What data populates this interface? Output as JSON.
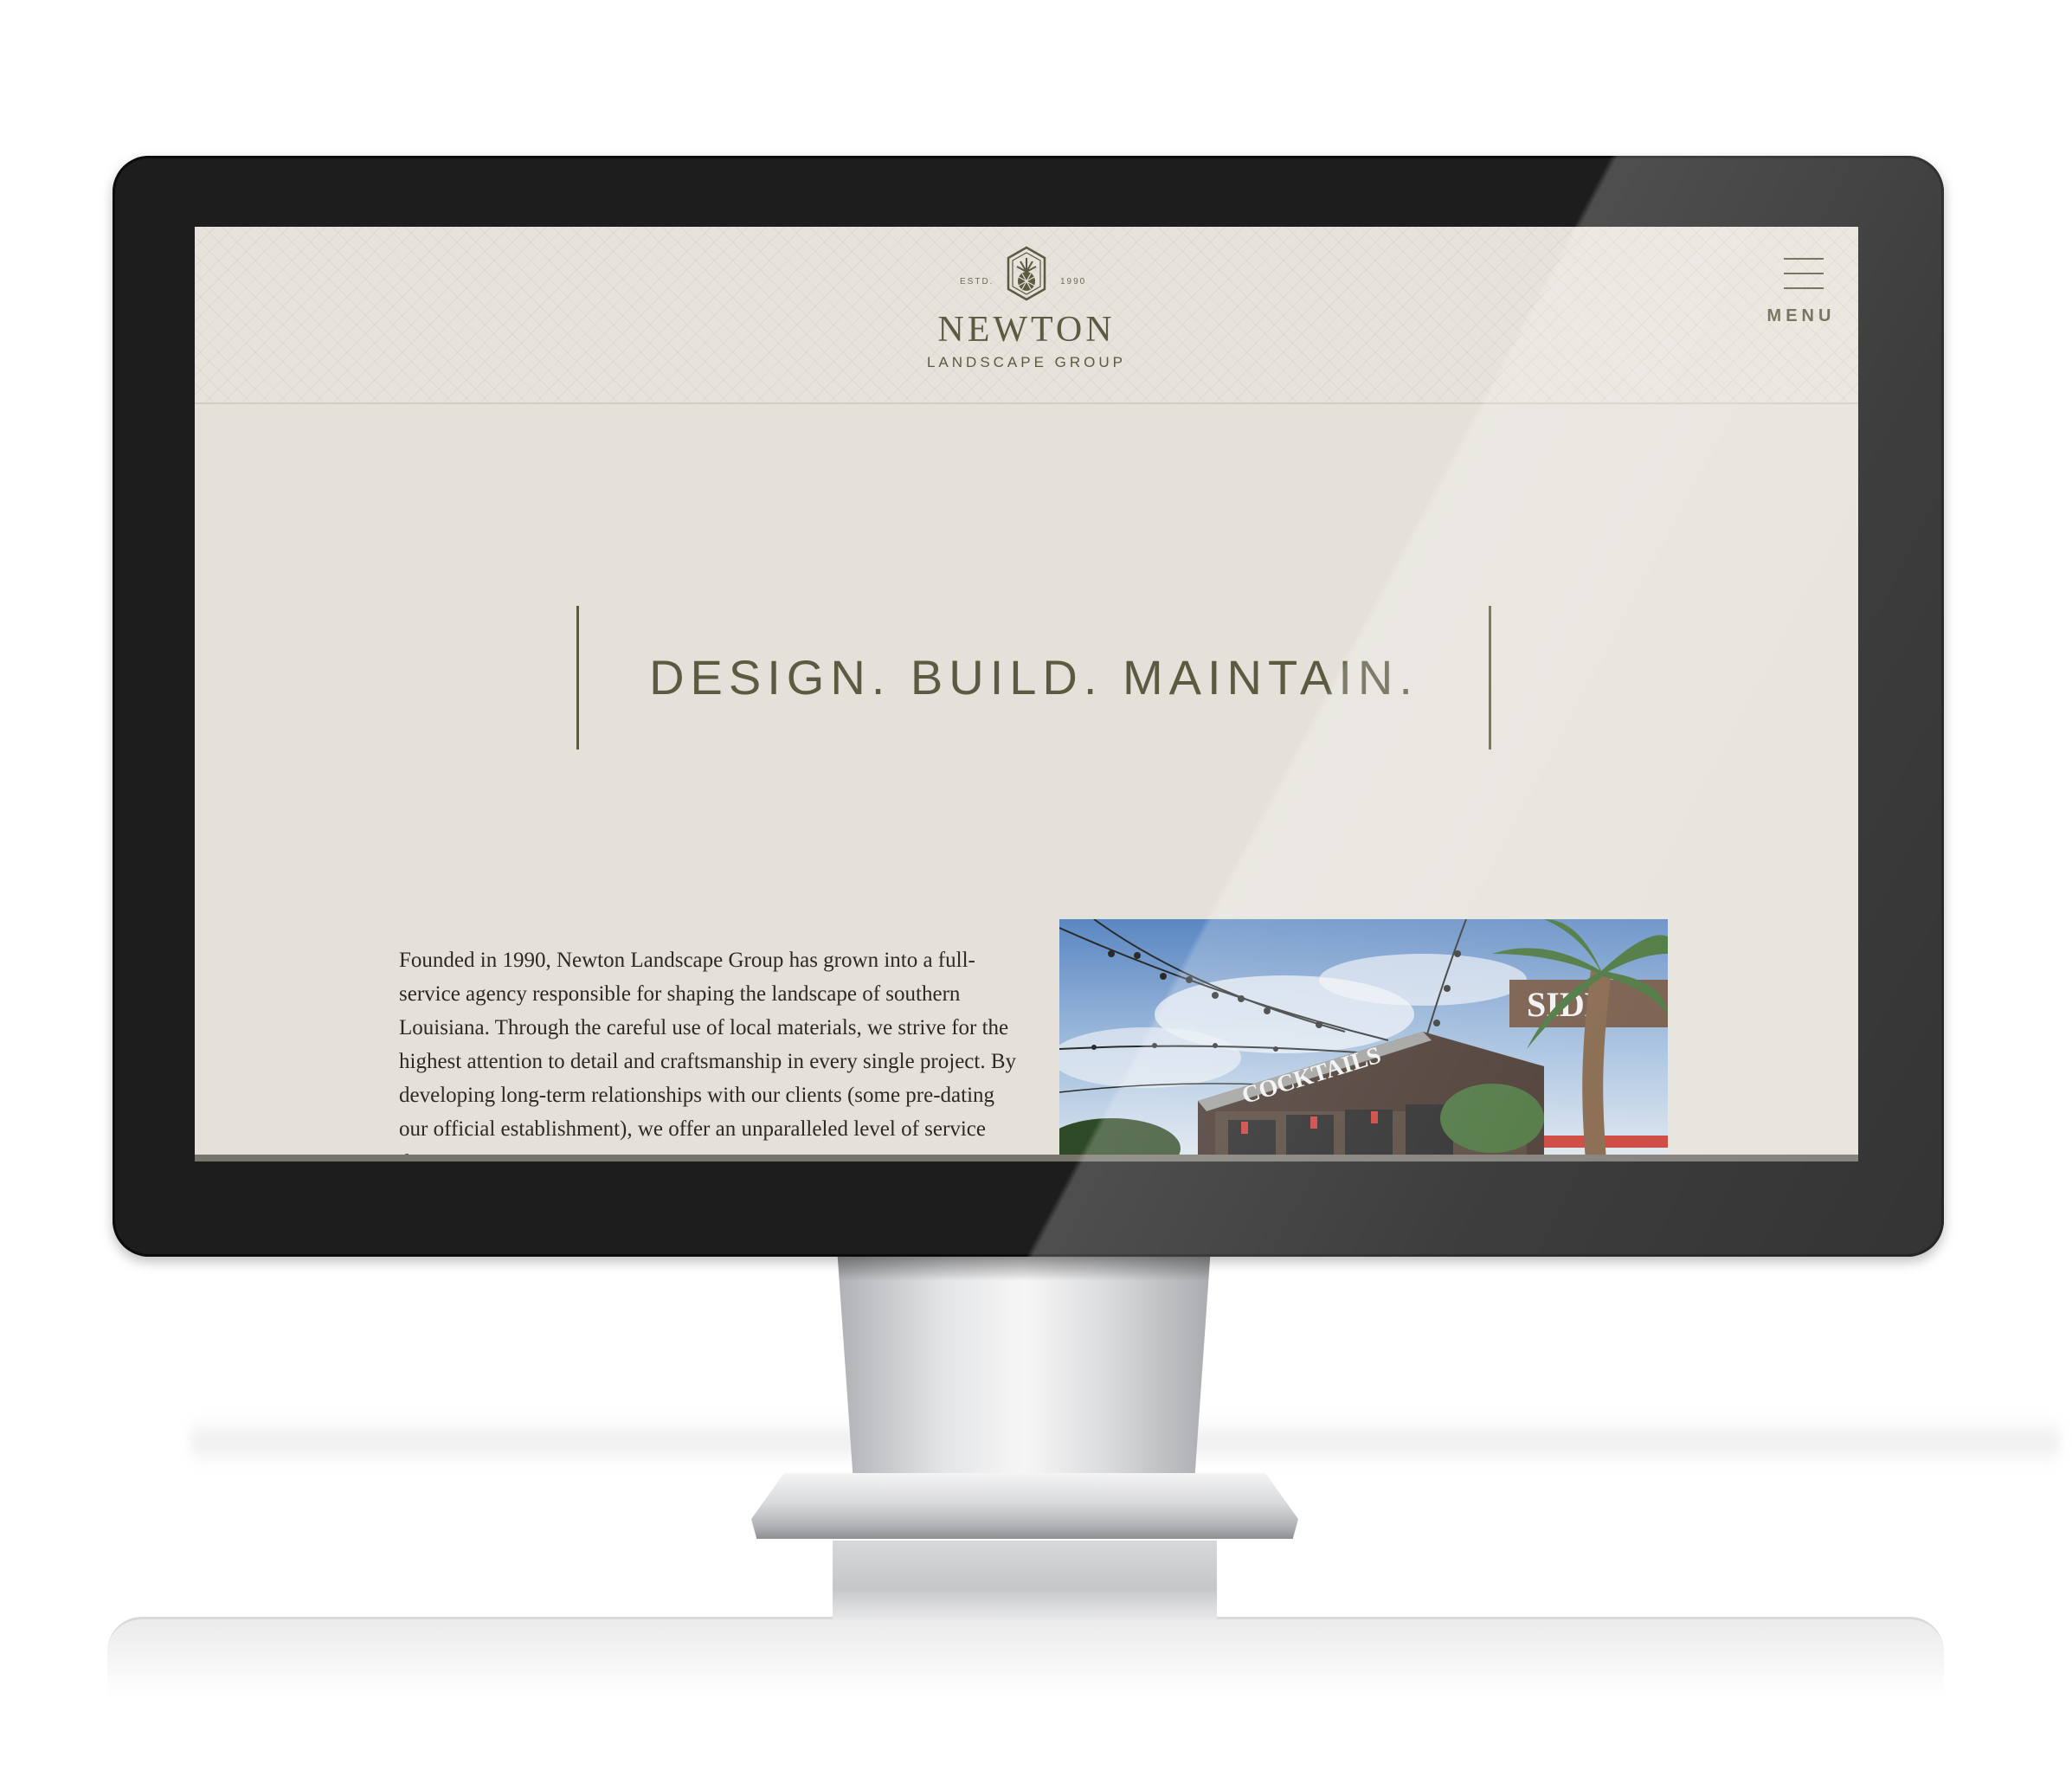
{
  "header": {
    "logo": {
      "estd": "ESTD.",
      "year": "1990",
      "name": "NEWTON",
      "subtitle": "LANDSCAPE GROUP"
    },
    "menu_label": "MENU"
  },
  "hero": {
    "title": "DESIGN. BUILD. MAINTAIN."
  },
  "intro": {
    "text": "Founded in 1990, Newton Landscape Group has grown into a full-service agency responsible for shaping the landscape of southern Louisiana. Through the careful use of local materials, we strive for the highest attention to detail and craftsmanship in every single project. By developing long-term relationships with our clients (some pre-dating our official establishment), we offer an unparalleled level of service that continues to span",
    "photo": {
      "sign_text": "COCKTAILS",
      "rooftop_sign_text": "SIDE"
    }
  },
  "colors": {
    "brand_olive": "#5c5a41",
    "page_background": "#e5e1da",
    "header_background": "#e7e3dc",
    "body_text": "#2b2a24",
    "bezel": "#1d1d1d"
  },
  "icons": {
    "menu": "hamburger-icon",
    "logo_emblem": "pineapple-emblem-icon"
  }
}
